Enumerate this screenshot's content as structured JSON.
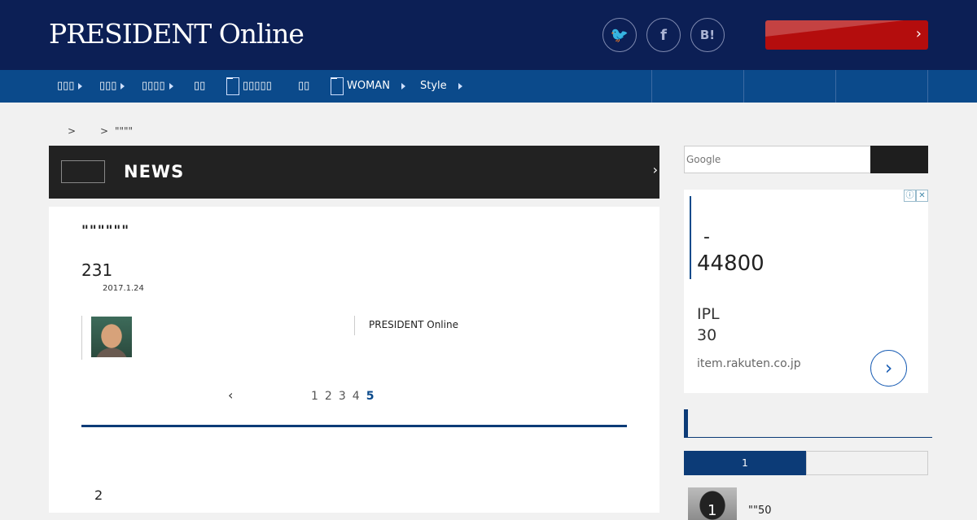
{
  "header": {
    "logo": "PRESIDENT Online",
    "social": [
      {
        "icon": "twitter-icon",
        "glyph": "🐦"
      },
      {
        "icon": "facebook-icon",
        "glyph": "f"
      },
      {
        "icon": "hatena-bookmark-icon",
        "glyph": "B!"
      }
    ]
  },
  "nav": {
    "items": [
      "▯▯▯",
      "▯▯▯",
      "▯▯▯▯",
      "▯▯",
      "▯▯▯▯▯",
      "▯▯",
      "WOMAN",
      "Style"
    ]
  },
  "breadcrumb": {
    "sep1": ">",
    "sep2": ">",
    "current": "\"\"\"\""
  },
  "section": {
    "title": "NEWS",
    "chevron": "›"
  },
  "article": {
    "title": "\"\"\"\"\"\"",
    "number": "231",
    "date": "2017.1.24",
    "publisher": "PRESIDENT Online",
    "pager": {
      "prev": "‹",
      "pages": [
        "1",
        "2",
        "3",
        "4",
        "5"
      ],
      "current": "5"
    },
    "sub_number": "2"
  },
  "search": {
    "placeholder": "Google"
  },
  "ad": {
    "dash": "-",
    "price": "44800",
    "line1": "IPL",
    "line2": "30",
    "url": "item.rakuten.co.jp",
    "go": "›",
    "info_icon": "ⓘ",
    "close_icon": "✕"
  },
  "ranking": {
    "tab1": "1",
    "item": {
      "rank": "1",
      "title": "\"\"50"
    }
  },
  "colors": {
    "header_bg": "#0c1f55",
    "nav_bg": "#0b4a8b",
    "accent_red": "#b40d0d",
    "accent_blue": "#0c3b77"
  }
}
